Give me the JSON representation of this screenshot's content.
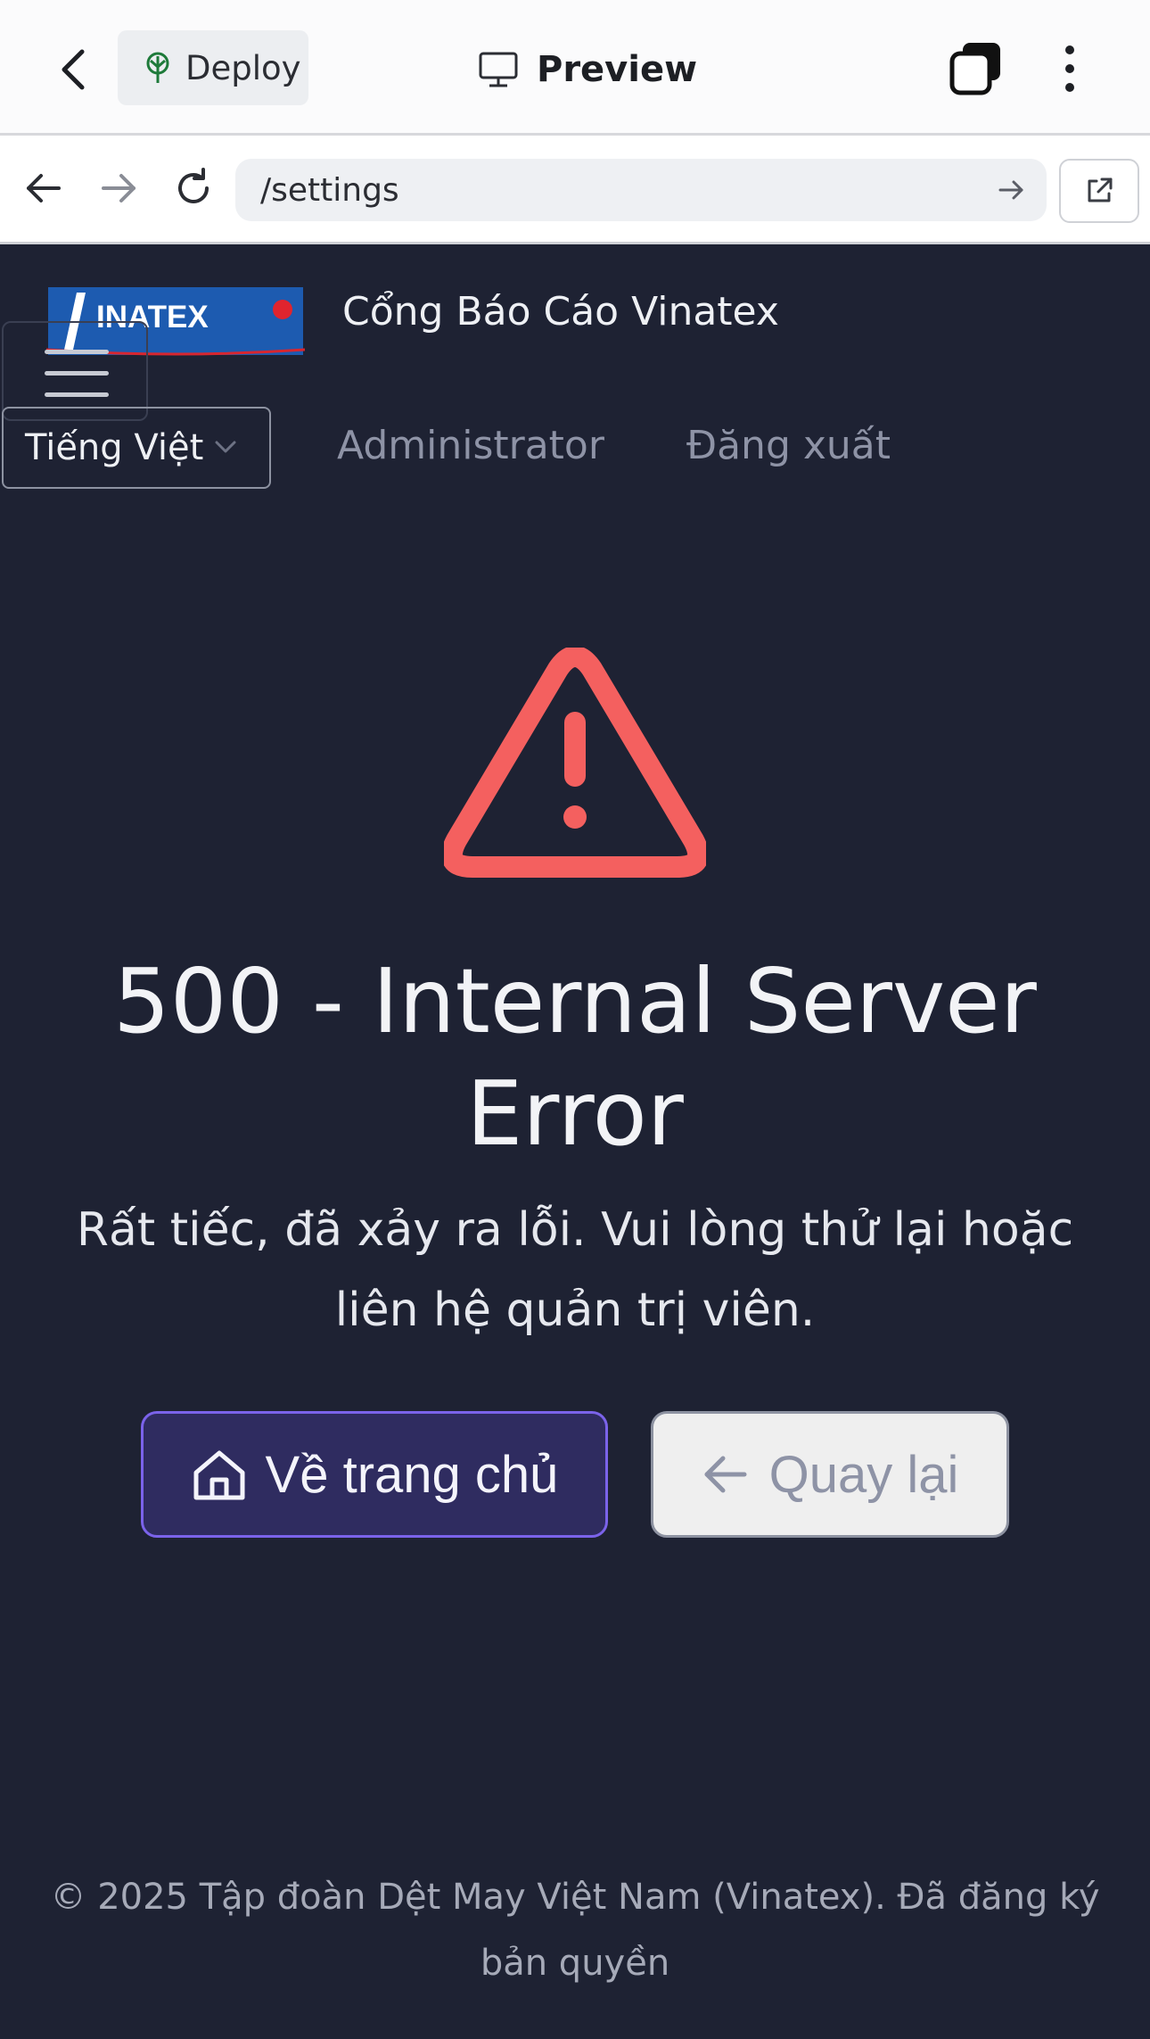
{
  "topbar": {
    "deploy_label": "Deploy",
    "preview_label": "Preview"
  },
  "urlbar": {
    "url": "/settings"
  },
  "header": {
    "logo_text": "INATEX",
    "site_title": "Cổng Báo Cáo Vinatex",
    "language": "Tiếng Việt",
    "nav": [
      "Administrator",
      "Đăng xuất"
    ]
  },
  "error": {
    "title": "500 - Internal Server Error",
    "message": "Rất tiếc, đã xảy ra lỗi. Vui lòng thử lại hoặc liên hệ quản trị viên.",
    "home_button": "Về trang chủ",
    "back_button": "Quay lại",
    "icon": "warning-triangle-icon"
  },
  "footer": {
    "text": "© 2025 Tập đoàn Dệt May Việt Nam (Vinatex). Đã đăng ký bản quyền"
  },
  "colors": {
    "background": "#1e2233",
    "accent": "#7b63ea",
    "danger": "#f4605f",
    "logo_blue": "#1d5bb0"
  }
}
